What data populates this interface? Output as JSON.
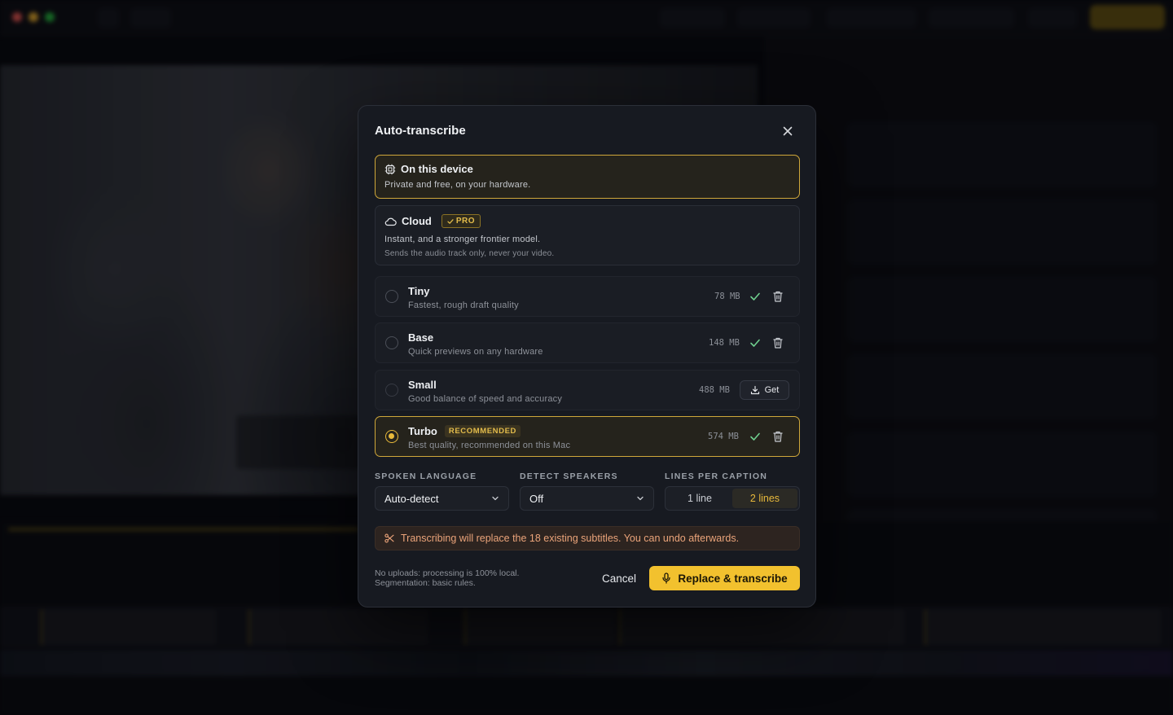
{
  "modal": {
    "title": "Auto-transcribe",
    "options": {
      "device": {
        "title": "On this device",
        "subtitle": "Private and free, on your hardware."
      },
      "cloud": {
        "title": "Cloud",
        "badge": "PRO",
        "subtitle": "Instant, and a stronger frontier model.",
        "note": "Sends the audio track only, never your video."
      }
    },
    "models": [
      {
        "name": "Tiny",
        "desc": "Fastest, rough draft quality",
        "size": "78 MB",
        "installed": true
      },
      {
        "name": "Base",
        "desc": "Quick previews on any hardware",
        "size": "148 MB",
        "installed": true
      },
      {
        "name": "Small",
        "desc": "Good balance of speed and accuracy",
        "size": "488 MB",
        "installed": false,
        "action": "Get"
      },
      {
        "name": "Turbo",
        "badge": "RECOMMENDED",
        "desc": "Best quality, recommended on this Mac",
        "size": "574 MB",
        "installed": true,
        "selected": true
      }
    ],
    "settings": {
      "language": {
        "label": "SPOKEN LANGUAGE",
        "value": "Auto-detect"
      },
      "speakers": {
        "label": "DETECT SPEAKERS",
        "value": "Off"
      },
      "lines": {
        "label": "LINES PER CAPTION",
        "options": [
          "1 line",
          "2 lines"
        ],
        "selected": "2 lines"
      }
    },
    "warning": "Transcribing will replace the 18 existing subtitles. You can undo afterwards.",
    "footer": {
      "note_line1": "No uploads: processing is 100% local.",
      "note_line2": "Segmentation: basic rules.",
      "cancel": "Cancel",
      "primary": "Replace & transcribe"
    }
  },
  "colors": {
    "accent": "#f2c12e",
    "warning_text": "#eba47a",
    "check": "#6fcf8e"
  }
}
